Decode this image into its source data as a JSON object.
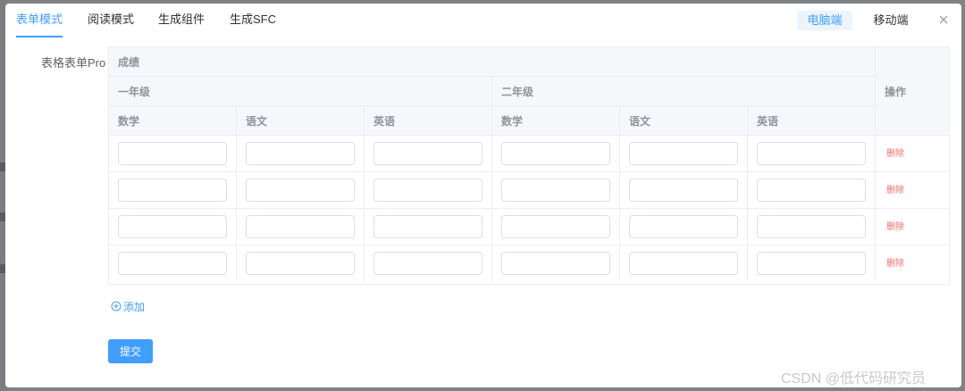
{
  "tabs": [
    {
      "label": "表单模式",
      "active": true
    },
    {
      "label": "阅读模式",
      "active": false
    },
    {
      "label": "生成组件",
      "active": false
    },
    {
      "label": "生成SFC",
      "active": false
    }
  ],
  "device_toggle": {
    "options": [
      "电脑端",
      "移动端"
    ],
    "selected": "电脑端"
  },
  "close_icon": "close-icon",
  "form": {
    "label": "表格表单Pro"
  },
  "table": {
    "group_header": "成绩",
    "subgroups": [
      "一年级",
      "二年级"
    ],
    "columns": [
      "数学",
      "语文",
      "英语",
      "数学",
      "语文",
      "英语"
    ],
    "actions_header": "操作",
    "rows": [
      {
        "values": [
          "",
          "",
          "",
          "",
          "",
          ""
        ],
        "action": "删除"
      },
      {
        "values": [
          "",
          "",
          "",
          "",
          "",
          ""
        ],
        "action": "删除"
      },
      {
        "values": [
          "",
          "",
          "",
          "",
          "",
          ""
        ],
        "action": "删除"
      },
      {
        "values": [
          "",
          "",
          "",
          "",
          "",
          ""
        ],
        "action": "删除"
      }
    ]
  },
  "add_button": {
    "icon": "plus-circle-icon",
    "label": "添加"
  },
  "submit_button": {
    "label": "提交"
  },
  "watermark": "CSDN @低代码研究员",
  "colors": {
    "accent": "#409eff",
    "danger": "#f56c6c",
    "header_bg": "#f5f7fa"
  }
}
